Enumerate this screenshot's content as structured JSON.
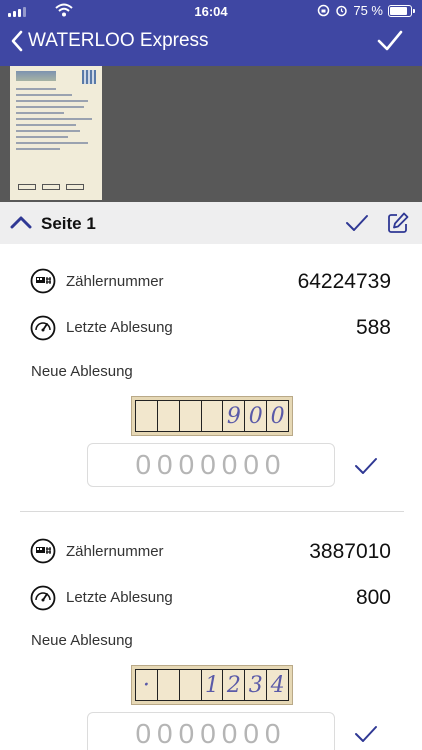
{
  "status_bar": {
    "time": "16:04",
    "battery_text": "75 %",
    "battery_level": 0.75
  },
  "nav": {
    "back_title": "WATERLOO Express"
  },
  "section": {
    "label": "Seite 1"
  },
  "meters": [
    {
      "meter_number_label": "Zählernummer",
      "meter_number": "64224739",
      "last_reading_label": "Letzte Ablesung",
      "last_reading": "588",
      "new_reading_label": "Neue Ablesung",
      "crop_digits": [
        "",
        "",
        "",
        "",
        "9",
        "0",
        "0"
      ],
      "input_placeholder": "0000000"
    },
    {
      "meter_number_label": "Zählernummer",
      "meter_number": "3887010",
      "last_reading_label": "Letzte Ablesung",
      "last_reading": "800",
      "new_reading_label": "Neue Ablesung",
      "crop_digits": [
        "·",
        "",
        "",
        "1",
        "2",
        "3",
        "4"
      ],
      "input_placeholder": "0000000"
    }
  ],
  "colors": {
    "header": "#3f47a3",
    "accent": "#2f3894",
    "preview_bg": "#585858",
    "section_bg": "#eeeeef"
  }
}
